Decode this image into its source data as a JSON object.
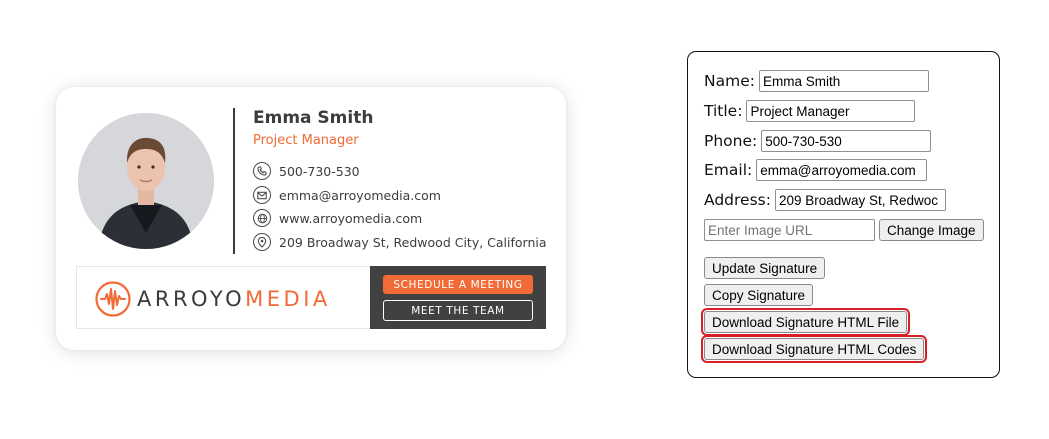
{
  "signature": {
    "name": "Emma Smith",
    "title": "Project Manager",
    "phone": "500-730-530",
    "email": "emma@arroyomedia.com",
    "website": "www.arroyomedia.com",
    "address": "209 Broadway St, Redwood City, California",
    "brand_part1": "ARROYO",
    "brand_part2": "MEDIA",
    "cta_primary": "SCHEDULE A MEETING",
    "cta_secondary": "MEET THE TEAM",
    "icons": [
      "phone-icon",
      "email-icon",
      "globe-icon",
      "location-icon"
    ]
  },
  "form": {
    "name_label": "Name:",
    "name_value": "Emma Smith",
    "title_label": "Title:",
    "title_value": "Project Manager",
    "phone_label": "Phone:",
    "phone_value": "500-730-530",
    "email_label": "Email:",
    "email_value": "emma@arroyomedia.com",
    "address_label": "Address:",
    "address_value": "209 Broadway St, Redwoc",
    "image_url_placeholder": "Enter Image URL",
    "change_image_label": "Change Image",
    "update_label": "Update Signature",
    "copy_label": "Copy Signature",
    "download_file_label": "Download Signature HTML File",
    "download_codes_label": "Download Signature HTML Codes"
  },
  "colors": {
    "accent": "#f26a35",
    "dark": "#414141",
    "highlight": "#d81f26"
  }
}
